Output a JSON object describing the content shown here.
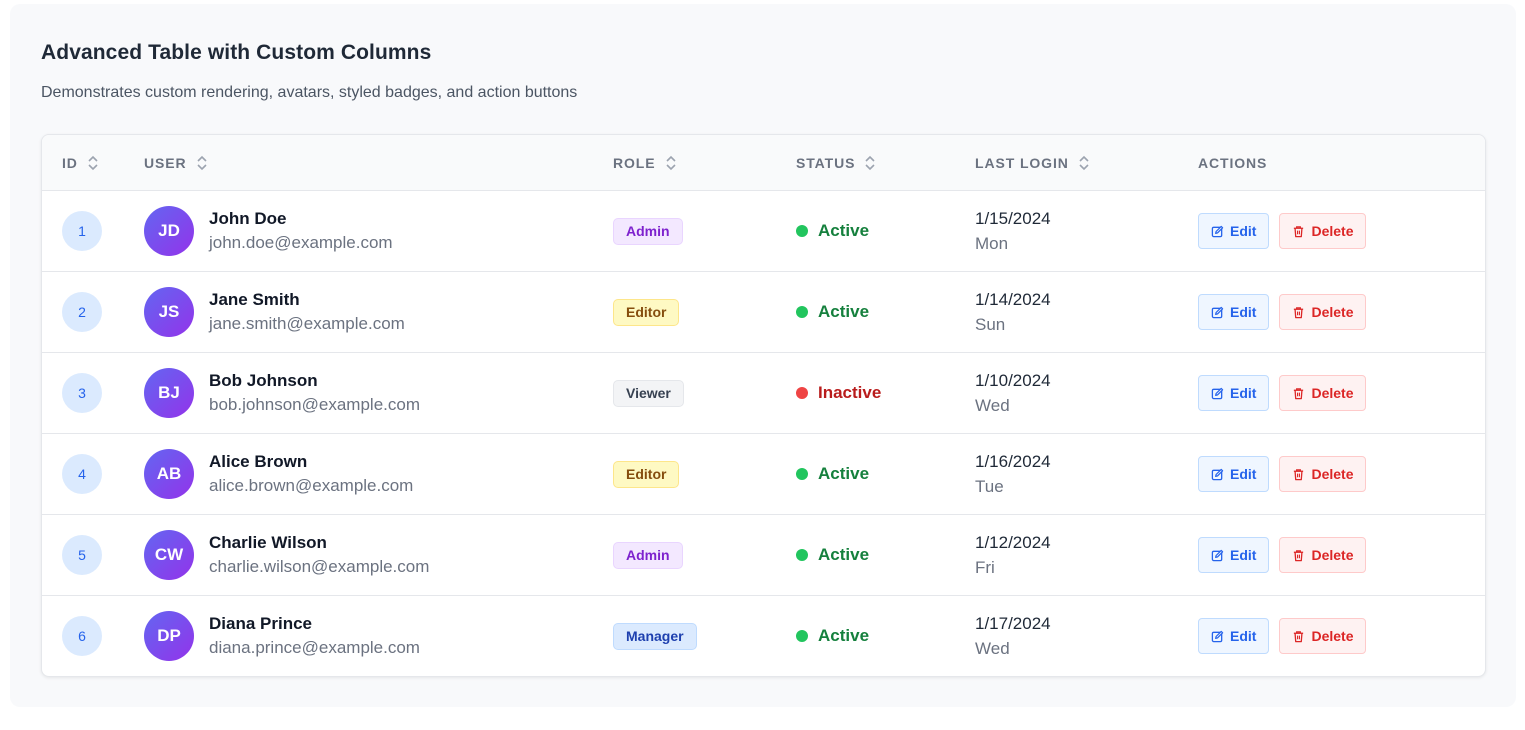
{
  "page": {
    "title": "Advanced Table with Custom Columns",
    "subtitle": "Demonstrates custom rendering, avatars, styled badges, and action buttons"
  },
  "columns": {
    "id": "ID",
    "user": "USER",
    "role": "ROLE",
    "status": "STATUS",
    "last_login": "LAST LOGIN",
    "actions": "ACTIONS"
  },
  "actions": {
    "edit_label": "Edit",
    "delete_label": "Delete"
  },
  "rows": [
    {
      "id": "1",
      "initials": "JD",
      "name": "John Doe",
      "email": "john.doe@example.com",
      "role": "Admin",
      "status": "Active",
      "date": "1/15/2024",
      "day": "Mon"
    },
    {
      "id": "2",
      "initials": "JS",
      "name": "Jane Smith",
      "email": "jane.smith@example.com",
      "role": "Editor",
      "status": "Active",
      "date": "1/14/2024",
      "day": "Sun"
    },
    {
      "id": "3",
      "initials": "BJ",
      "name": "Bob Johnson",
      "email": "bob.johnson@example.com",
      "role": "Viewer",
      "status": "Inactive",
      "date": "1/10/2024",
      "day": "Wed"
    },
    {
      "id": "4",
      "initials": "AB",
      "name": "Alice Brown",
      "email": "alice.brown@example.com",
      "role": "Editor",
      "status": "Active",
      "date": "1/16/2024",
      "day": "Tue"
    },
    {
      "id": "5",
      "initials": "CW",
      "name": "Charlie Wilson",
      "email": "charlie.wilson@example.com",
      "role": "Admin",
      "status": "Active",
      "date": "1/12/2024",
      "day": "Fri"
    },
    {
      "id": "6",
      "initials": "DP",
      "name": "Diana Prince",
      "email": "diana.prince@example.com",
      "role": "Manager",
      "status": "Active",
      "date": "1/17/2024",
      "day": "Wed"
    }
  ],
  "colors": {
    "active": "#15803d",
    "inactive": "#b91c1c",
    "avatar_gradient_start": "#6366f1",
    "avatar_gradient_end": "#9333ea"
  },
  "icons": {
    "sort": "sort-icon",
    "edit": "edit-icon",
    "delete": "trash-icon"
  }
}
